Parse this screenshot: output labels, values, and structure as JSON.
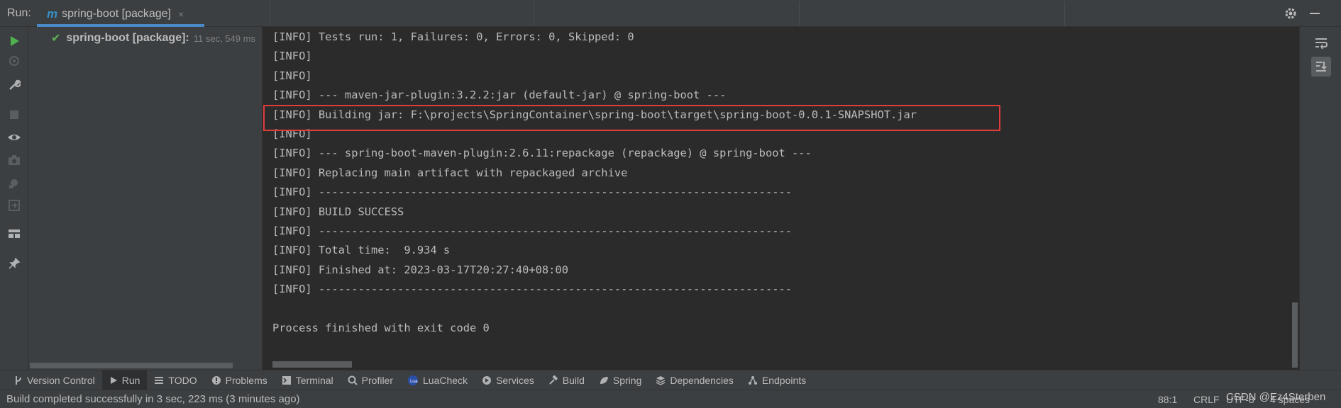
{
  "run_bar": {
    "label": "Run:",
    "tab_title": "spring-boot [package]",
    "tab_close": "×"
  },
  "tree": {
    "node_label": "spring-boot [package]:",
    "node_duration": "11 sec, 549 ms"
  },
  "console": {
    "lines": [
      "[INFO] Tests run: 1, Failures: 0, Errors: 0, Skipped: 0",
      "[INFO]",
      "[INFO]",
      "[INFO] --- maven-jar-plugin:3.2.2:jar (default-jar) @ spring-boot ---",
      "[INFO] Building jar: F:\\projects\\SpringContainer\\spring-boot\\target\\spring-boot-0.0.1-SNAPSHOT.jar",
      "[INFO]",
      "[INFO] --- spring-boot-maven-plugin:2.6.11:repackage (repackage) @ spring-boot ---",
      "[INFO] Replacing main artifact with repackaged archive",
      "[INFO] ------------------------------------------------------------------------",
      "[INFO] BUILD SUCCESS",
      "[INFO] ------------------------------------------------------------------------",
      "[INFO] Total time:  9.934 s",
      "[INFO] Finished at: 2023-03-17T20:27:40+08:00",
      "[INFO] ------------------------------------------------------------------------",
      "",
      "Process finished with exit code 0"
    ]
  },
  "tool_windows": [
    {
      "label": "Version Control",
      "icon": "branch-icon"
    },
    {
      "label": "Run",
      "icon": "play-icon",
      "active": true
    },
    {
      "label": "TODO",
      "icon": "list-icon"
    },
    {
      "label": "Problems",
      "icon": "info-icon"
    },
    {
      "label": "Terminal",
      "icon": "terminal-icon"
    },
    {
      "label": "Profiler",
      "icon": "profiler-icon"
    },
    {
      "label": "LuaCheck",
      "icon": "lua-icon"
    },
    {
      "label": "Services",
      "icon": "services-icon"
    },
    {
      "label": "Build",
      "icon": "hammer-icon"
    },
    {
      "label": "Spring",
      "icon": "spring-icon"
    },
    {
      "label": "Dependencies",
      "icon": "layers-icon"
    },
    {
      "label": "Endpoints",
      "icon": "endpoints-icon"
    }
  ],
  "status": {
    "message": "Build completed successfully in 3 sec, 223 ms (3 minutes ago)",
    "position": "88:1",
    "line_sep": "CRLF",
    "encoding": "UTF-8",
    "indent": "4 spaces",
    "watermark": "CSDN @Ez4Sterben"
  },
  "colors": {
    "highlight_box": "#e03c3c",
    "success_check": "#5fb157",
    "run_green": "#4fb24f",
    "accent": "#4a88c7"
  }
}
